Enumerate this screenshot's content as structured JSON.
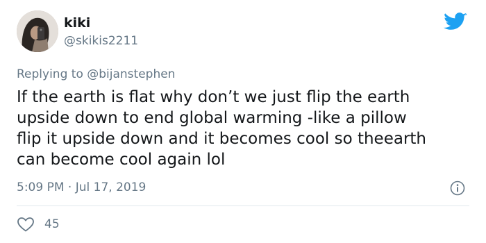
{
  "user": {
    "name": "kiki",
    "handle": "@skikis2211"
  },
  "reply": {
    "prefix": "Replying to ",
    "mention": "@bijanstephen"
  },
  "tweet": {
    "lines": [
      "If the earth is flat why don’t we just flip the earth",
      "upside down to end global warming -like a pillow",
      "flip it upside down and it becomes cool so theearth",
      "can become cool again lol"
    ],
    "timestamp": "5:09 PM · Jul 17, 2019"
  },
  "stats": {
    "likes": "45"
  },
  "icons": {
    "brand": "twitter-bird-icon",
    "info": "info-icon",
    "like": "heart-icon"
  },
  "colors": {
    "twitter_blue": "#1da1f2",
    "secondary_text": "#657786",
    "primary_text": "#14171a",
    "divider": "#e1e8ed"
  }
}
